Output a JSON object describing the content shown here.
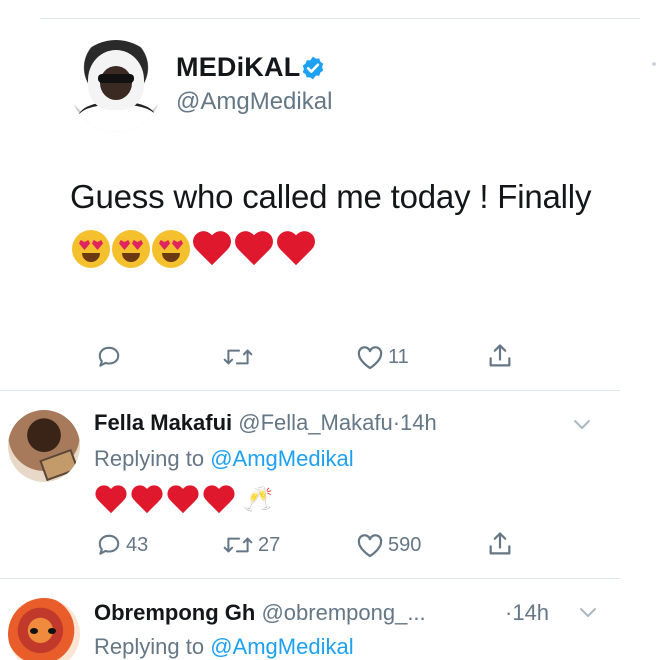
{
  "main_tweet": {
    "display_name": "MEDiKAL",
    "handle": "@AmgMedikal",
    "text": "Guess who called me today ! Finally",
    "emojis": [
      "heart-eyes",
      "heart-eyes",
      "heart-eyes",
      "red-heart",
      "red-heart",
      "red-heart"
    ],
    "actions": {
      "reply_icon": "reply-icon",
      "retweet_icon": "retweet-icon",
      "like_icon": "like-icon",
      "like_count": "11",
      "share_icon": "share-icon"
    }
  },
  "replies": [
    {
      "display_name": "Fella Makafui",
      "handle": "@Fella_Makafu",
      "separator": "·",
      "time": "14h",
      "replying_prefix": "Replying to",
      "replying_to": "@AmgMedikal",
      "emojis": [
        "red-heart",
        "red-heart",
        "red-heart",
        "red-heart",
        "clinking-glasses"
      ],
      "reply_count": "43",
      "retweet_count": "27",
      "like_count": "590"
    },
    {
      "display_name": "Obrempong Gh",
      "handle": "@obrempong_...",
      "separator": "·",
      "time": "14h",
      "replying_prefix": "Replying to",
      "replying_to": "@AmgMedikal"
    }
  ],
  "colors": {
    "text_primary": "#14171a",
    "text_secondary": "#657786",
    "link": "#1da1f2",
    "verified": "#1da1f2",
    "heart": "#e0182d",
    "divider": "#e1e8ed"
  }
}
